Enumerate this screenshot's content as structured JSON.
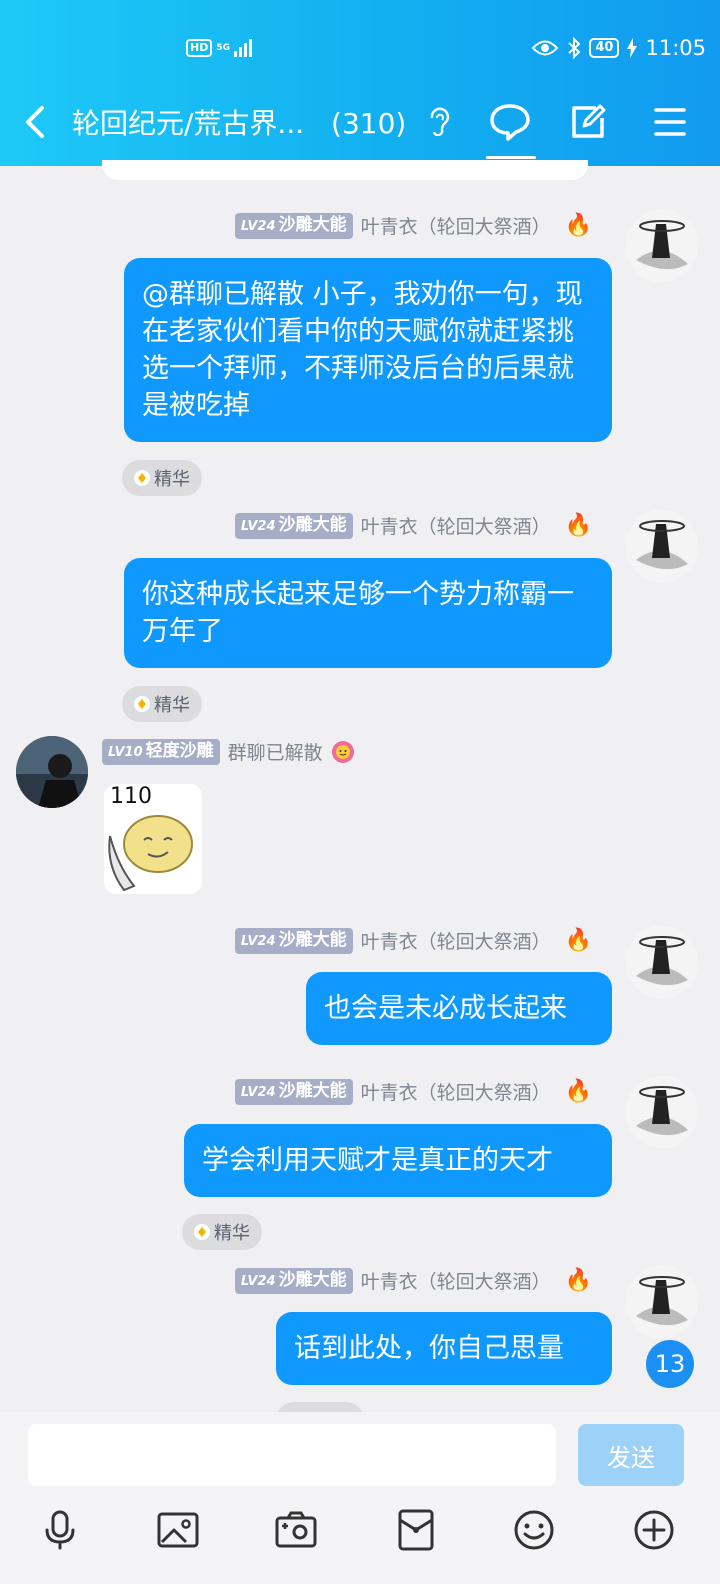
{
  "status_bar": {
    "network_hd": "HD",
    "network_5g": "5G",
    "battery": "40",
    "time": "11:05"
  },
  "header": {
    "title": "轮回纪元/荒古界...",
    "count": "(310)",
    "back_icon": "chevron-left-icon",
    "icons": [
      "ear-icon",
      "chat-bubble-icon",
      "edit-icon",
      "menu-icon"
    ]
  },
  "messages": [
    {
      "level": "LV24",
      "level_title": "沙雕大能",
      "nick": "叶青衣（轮回大祭酒）",
      "text": "@群聊已解散 小子，我劝你一句，现在老家伙们看中你的天赋你就赶紧挑选一个拜师，不拜师没后台的后果就是被吃掉",
      "tag": "精华"
    },
    {
      "level": "LV24",
      "level_title": "沙雕大能",
      "nick": "叶青衣（轮回大祭酒）",
      "text": "你这种成长起来足够一个势力称霸一万年了",
      "tag": "精华"
    },
    {
      "level": "LV10",
      "level_title": "轻度沙雕",
      "nick": "群聊已解散",
      "sticker_text": "110"
    },
    {
      "level": "LV24",
      "level_title": "沙雕大能",
      "nick": "叶青衣（轮回大祭酒）",
      "text": "也会是未必成长起来"
    },
    {
      "level": "LV24",
      "level_title": "沙雕大能",
      "nick": "叶青衣（轮回大祭酒）",
      "text": "学会利用天赋才是真正的天才",
      "tag": "精华"
    },
    {
      "level": "LV24",
      "level_title": "沙雕大能",
      "nick": "叶青衣（轮回大祭酒）",
      "text": "话到此处，你自己思量"
    }
  ],
  "unread_count": "13",
  "input": {
    "placeholder": "",
    "send_label": "发送"
  },
  "toolbar": [
    "mic-icon",
    "image-icon",
    "camera-icon",
    "red-packet-icon",
    "emoji-icon",
    "plus-icon"
  ],
  "colors": {
    "header": "#12aff0",
    "bubble": "#0f99ff",
    "level_badge": "#a6adc6",
    "send_disabled": "#9dd2f8"
  }
}
